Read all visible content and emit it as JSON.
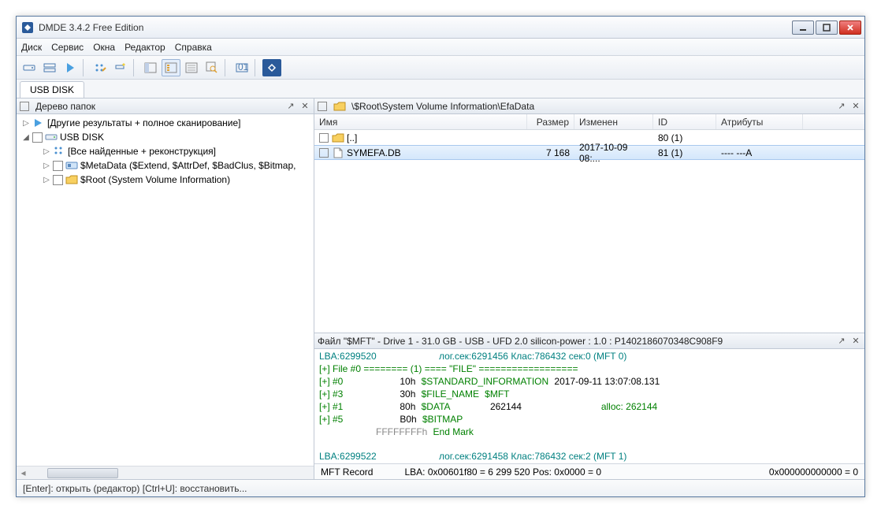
{
  "title": "DMDE 3.4.2 Free Edition",
  "menu": {
    "disk": "Диск",
    "service": "Сервис",
    "windows": "Окна",
    "editor": "Редактор",
    "help": "Справка"
  },
  "tabs": {
    "main": "USB DISK"
  },
  "tree": {
    "header": "Дерево папок",
    "items": [
      "[Другие результаты + полное сканирование]",
      "USB DISK",
      "[Все найденные + реконструкция]",
      "$MetaData ($Extend, $AttrDef, $BadClus, $Bitmap,",
      "$Root (System Volume Information)"
    ]
  },
  "files": {
    "path": "\\$Root\\System Volume Information\\EfaData",
    "columns": {
      "name": "Имя",
      "size": "Размер",
      "modified": "Изменен",
      "id": "ID",
      "attrs": "Атрибуты"
    },
    "rows": [
      {
        "name": "[..]",
        "size": "",
        "modified": "",
        "id": "80 (1)",
        "attrs": ""
      },
      {
        "name": "SYMEFA.DB",
        "size": "7 168",
        "modified": "2017-10-09 08:...",
        "id": "81 (1)",
        "attrs": "---- ---A"
      }
    ]
  },
  "log": {
    "header": "Файл \"$MFT\" - Drive 1 - 31.0 GB - USB - UFD 2.0 silicon-power   : 1.0 : P1402186070348C908F9",
    "l1a": "LBA:6299520",
    "l1b": "лог.сек:6291456 Клас:786432 сек:0 (MFT 0)",
    "l2": "[+] File #0 ======== (1) ==== \"FILE\" ==================",
    "l3a": "[+] #0",
    "l3b": "10h",
    "l3c": "$STANDARD_INFORMATION",
    "l3d": "2017-09-11 13:07:08.131",
    "l4a": "[+] #3",
    "l4b": "30h",
    "l4c": "$FILE_NAME",
    "l4d": "$MFT",
    "l5a": "[+] #1",
    "l5b": "80h",
    "l5c": "$DATA",
    "l5d": "262144",
    "l5e": "alloc: 262144",
    "l6a": "[+] #5",
    "l6b": "B0h",
    "l6c": "$BITMAP",
    "l7a": "FFFFFFFFh",
    "l7b": "End Mark",
    "l8a": "LBA:6299522",
    "l8b": "лог.сек:6291458 Клас:786432 сек:2 (MFT 1)",
    "status": {
      "a": "MFT Record",
      "b": "LBA: 0x00601f80 = 6 299 520  Pos: 0x0000 = 0",
      "c": "0x000000000000 = 0"
    }
  },
  "statusbar": "[Enter]: открыть (редактор)  [Ctrl+U]: восстановить..."
}
